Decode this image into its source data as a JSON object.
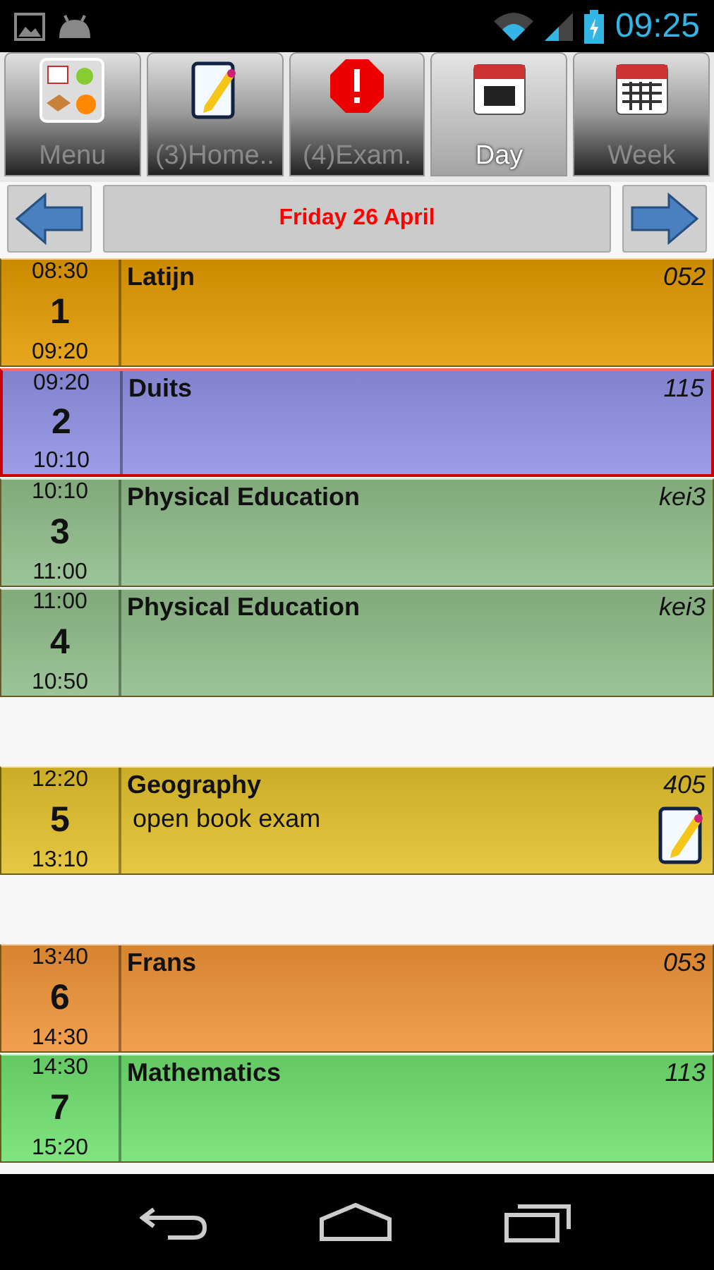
{
  "status_bar": {
    "time": "09:25"
  },
  "tabs": [
    {
      "label": "Menu",
      "kind": "menu",
      "selected": false
    },
    {
      "label": "(3)Home..",
      "kind": "homework",
      "selected": false
    },
    {
      "label": "(4)Exam.",
      "kind": "exam",
      "selected": false
    },
    {
      "label": "Day",
      "kind": "day",
      "selected": true
    },
    {
      "label": "Week",
      "kind": "week",
      "selected": false
    }
  ],
  "date_bar": {
    "title": "Friday 26 April"
  },
  "entries": [
    {
      "kind": "lesson",
      "start": "08:30",
      "number": "1",
      "end": "09:20",
      "subject": "Latijn",
      "room": "052",
      "color": "#e39a00",
      "selected": false,
      "homework": false
    },
    {
      "kind": "lesson",
      "start": "09:20",
      "number": "2",
      "end": "10:10",
      "subject": "Duits",
      "room": "115",
      "color": "#9090e4",
      "selected": true,
      "homework": false
    },
    {
      "kind": "lesson",
      "start": "10:10",
      "number": "3",
      "end": "11:00",
      "subject": "Physical Education",
      "room": "kei3",
      "color": "#90bc8a",
      "selected": false,
      "homework": false
    },
    {
      "kind": "lesson",
      "start": "11:00",
      "number": "4",
      "end": "10:50",
      "subject": "Physical Education",
      "room": "kei3",
      "color": "#90bc8a",
      "selected": false,
      "homework": false
    },
    {
      "kind": "gap"
    },
    {
      "kind": "lesson",
      "start": "12:20",
      "number": "5",
      "end": "13:10",
      "subject": "Geography",
      "room": "405",
      "note": "open book exam",
      "color": "#e2c02a",
      "selected": false,
      "homework": true
    },
    {
      "kind": "gap"
    },
    {
      "kind": "lesson",
      "start": "13:40",
      "number": "6",
      "end": "14:30",
      "subject": "Frans",
      "room": "053",
      "color": "#ee9336",
      "selected": false,
      "homework": false
    },
    {
      "kind": "lesson",
      "start": "14:30",
      "number": "7",
      "end": "15:20",
      "subject": "Mathematics",
      "room": "113",
      "color": "#6fe06f",
      "selected": false,
      "homework": false
    }
  ]
}
